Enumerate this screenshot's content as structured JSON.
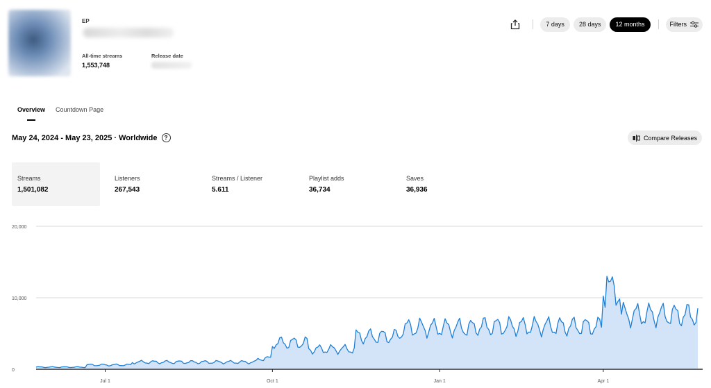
{
  "release": {
    "type": "EP",
    "all_time_label": "All-time streams",
    "all_time_value": "1,553,748",
    "release_date_label": "Release date"
  },
  "toolbar": {
    "share_icon": "share-icon",
    "ranges": [
      "7 days",
      "28 days",
      "12 months"
    ],
    "active_range": "12 months",
    "filters_label": "Filters"
  },
  "tabs": [
    "Overview",
    "Countdown Page"
  ],
  "active_tab": "Overview",
  "date_range": "May 24, 2024 - May 23, 2025 · Worldwide",
  "help_icon": "?",
  "compare_label": "Compare Releases",
  "stats": [
    {
      "label": "Streams",
      "value": "1,501,082",
      "active": true
    },
    {
      "label": "Listeners",
      "value": "267,543",
      "active": false
    },
    {
      "label": "Streams / Listener",
      "value": "5.611",
      "active": false
    },
    {
      "label": "Playlist adds",
      "value": "36,734",
      "active": false
    },
    {
      "label": "Saves",
      "value": "36,936",
      "active": false
    }
  ],
  "colors": {
    "line": "#1e7fd6",
    "fill": "#d4e4f8",
    "grid": "#d8d8d8",
    "axis": "#222222"
  },
  "chart_data": {
    "type": "area",
    "series": [
      {
        "values": []
      }
    ],
    "x_start": "2024-05-24",
    "x_end": "2025-05-23",
    "x_ticks": [
      {
        "label": "Jul 1",
        "date": "2024-07-01"
      },
      {
        "label": "Oct 1",
        "date": "2024-10-01"
      },
      {
        "label": "Jan 1",
        "date": "2025-01-01"
      },
      {
        "label": "Apr 1",
        "date": "2025-04-01"
      }
    ],
    "y_ticks": [
      {
        "label": "0",
        "value": 0
      },
      {
        "label": "10,000",
        "value": 10000
      },
      {
        "label": "20,000",
        "value": 20000
      }
    ],
    "ylim": [
      0,
      20000
    ],
    "grid": true,
    "daily_segments": [
      {
        "from": "2024-05-24",
        "to": "2024-06-20",
        "level": 300
      },
      {
        "from": "2024-06-20",
        "to": "2024-07-15",
        "level": 600
      },
      {
        "from": "2024-07-15",
        "to": "2024-09-22",
        "level": 1000
      },
      {
        "from": "2024-09-22",
        "to": "2024-09-30",
        "level": 1500
      },
      {
        "from": "2024-10-01",
        "to": "2024-10-20",
        "level": 3700
      },
      {
        "from": "2024-10-20",
        "to": "2024-11-15",
        "level": 2800
      },
      {
        "from": "2024-11-15",
        "to": "2024-12-10",
        "level": 4600
      },
      {
        "from": "2024-12-10",
        "to": "2025-01-20",
        "level": 5800
      },
      {
        "from": "2025-01-20",
        "to": "2025-03-31",
        "level": 6000
      },
      {
        "from": "2025-04-01",
        "to": "2025-04-10",
        "level": 11000
      },
      {
        "from": "2025-04-10",
        "to": "2025-05-23",
        "level": 7600
      }
    ],
    "peak": {
      "date": "2025-04-03",
      "value": 13000
    }
  }
}
